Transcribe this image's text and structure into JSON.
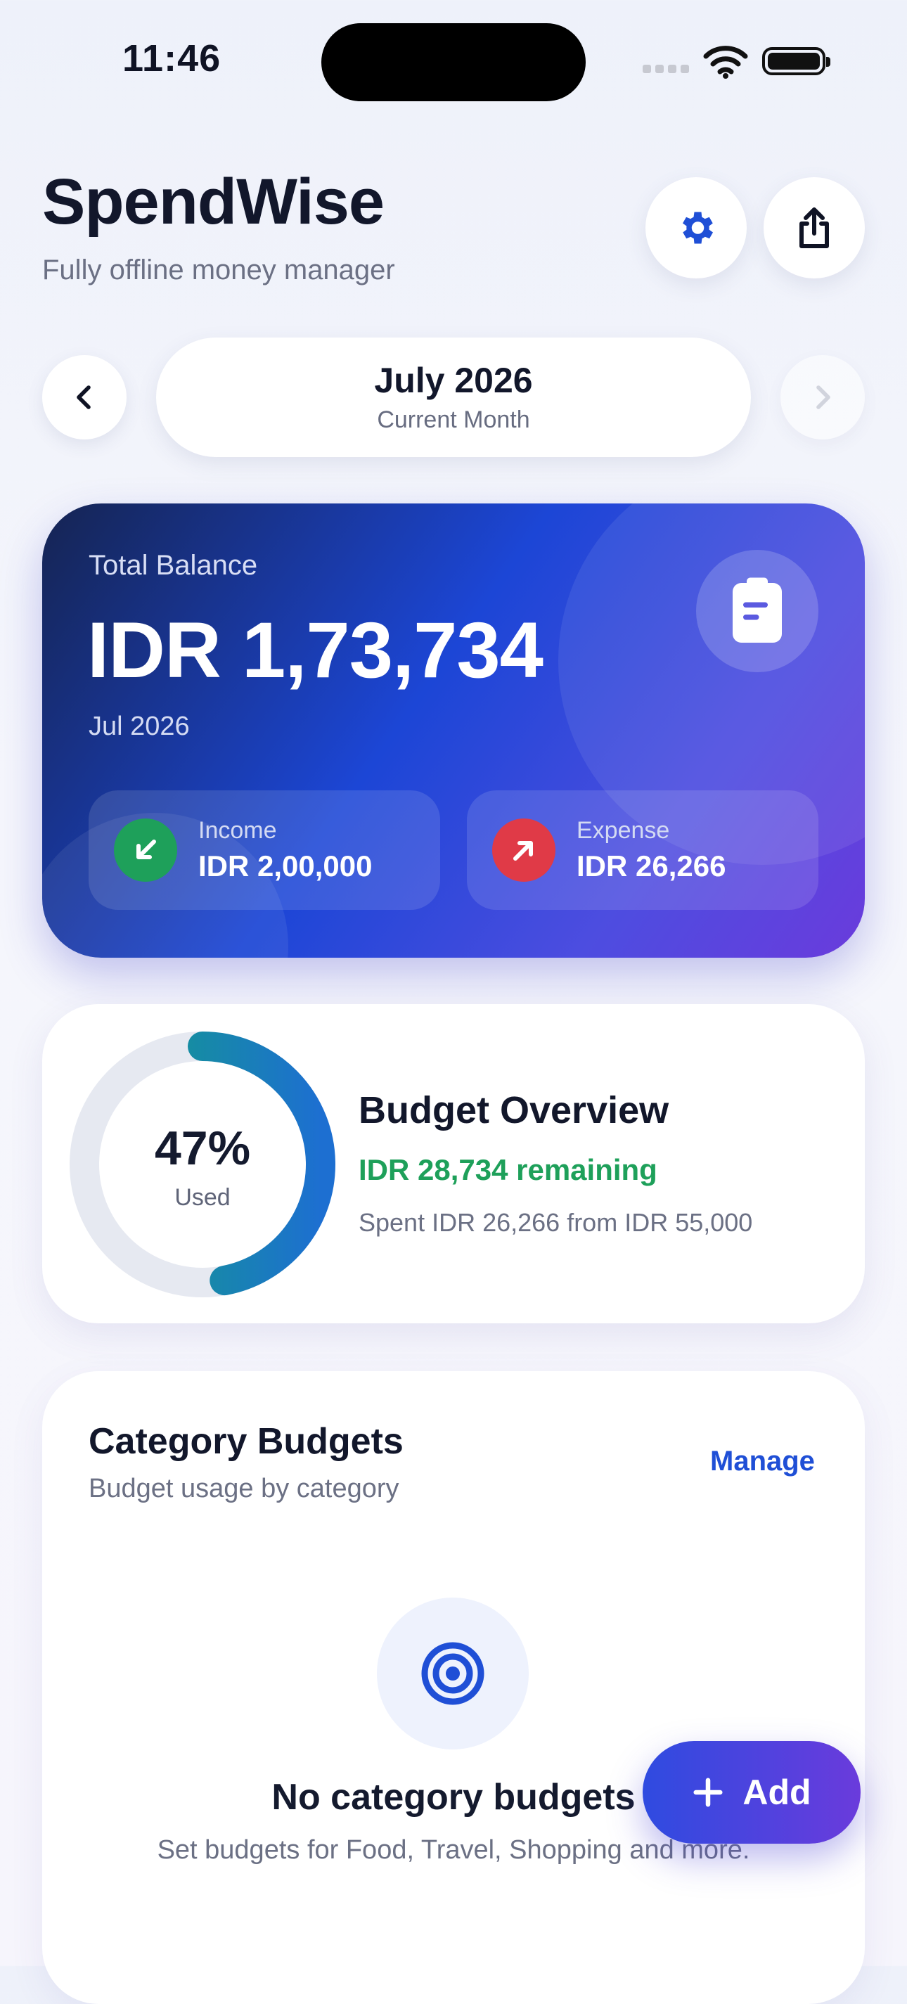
{
  "status_bar": {
    "time": "11:46"
  },
  "header": {
    "title": "SpendWise",
    "subtitle": "Fully offline money manager"
  },
  "month_nav": {
    "month": "July 2026",
    "caption": "Current Month"
  },
  "balance_card": {
    "label": "Total Balance",
    "value": "IDR 1,73,734",
    "period": "Jul 2026",
    "income": {
      "label": "Income",
      "value": "IDR 2,00,000"
    },
    "expense": {
      "label": "Expense",
      "value": "IDR 26,266"
    }
  },
  "budget_overview": {
    "percent_text": "47%",
    "used_label": "Used",
    "used_fraction": 0.47,
    "title": "Budget Overview",
    "remaining": "IDR 28,734 remaining",
    "spent_line": "Spent IDR 26,266 from IDR 55,000"
  },
  "category_budgets": {
    "title": "Category Budgets",
    "subtitle": "Budget usage by category",
    "manage_label": "Manage",
    "empty_title": "No category budgets",
    "empty_description": "Set budgets for Food, Travel, Shopping and more."
  },
  "fab": {
    "label": "Add"
  },
  "colors": {
    "accent": "#1f4fd6",
    "income": "#1ea05a",
    "expense": "#e03a47",
    "donut_start": "#10a37f",
    "donut_end": "#1d6fd1",
    "donut_track": "#e6e9f1"
  }
}
